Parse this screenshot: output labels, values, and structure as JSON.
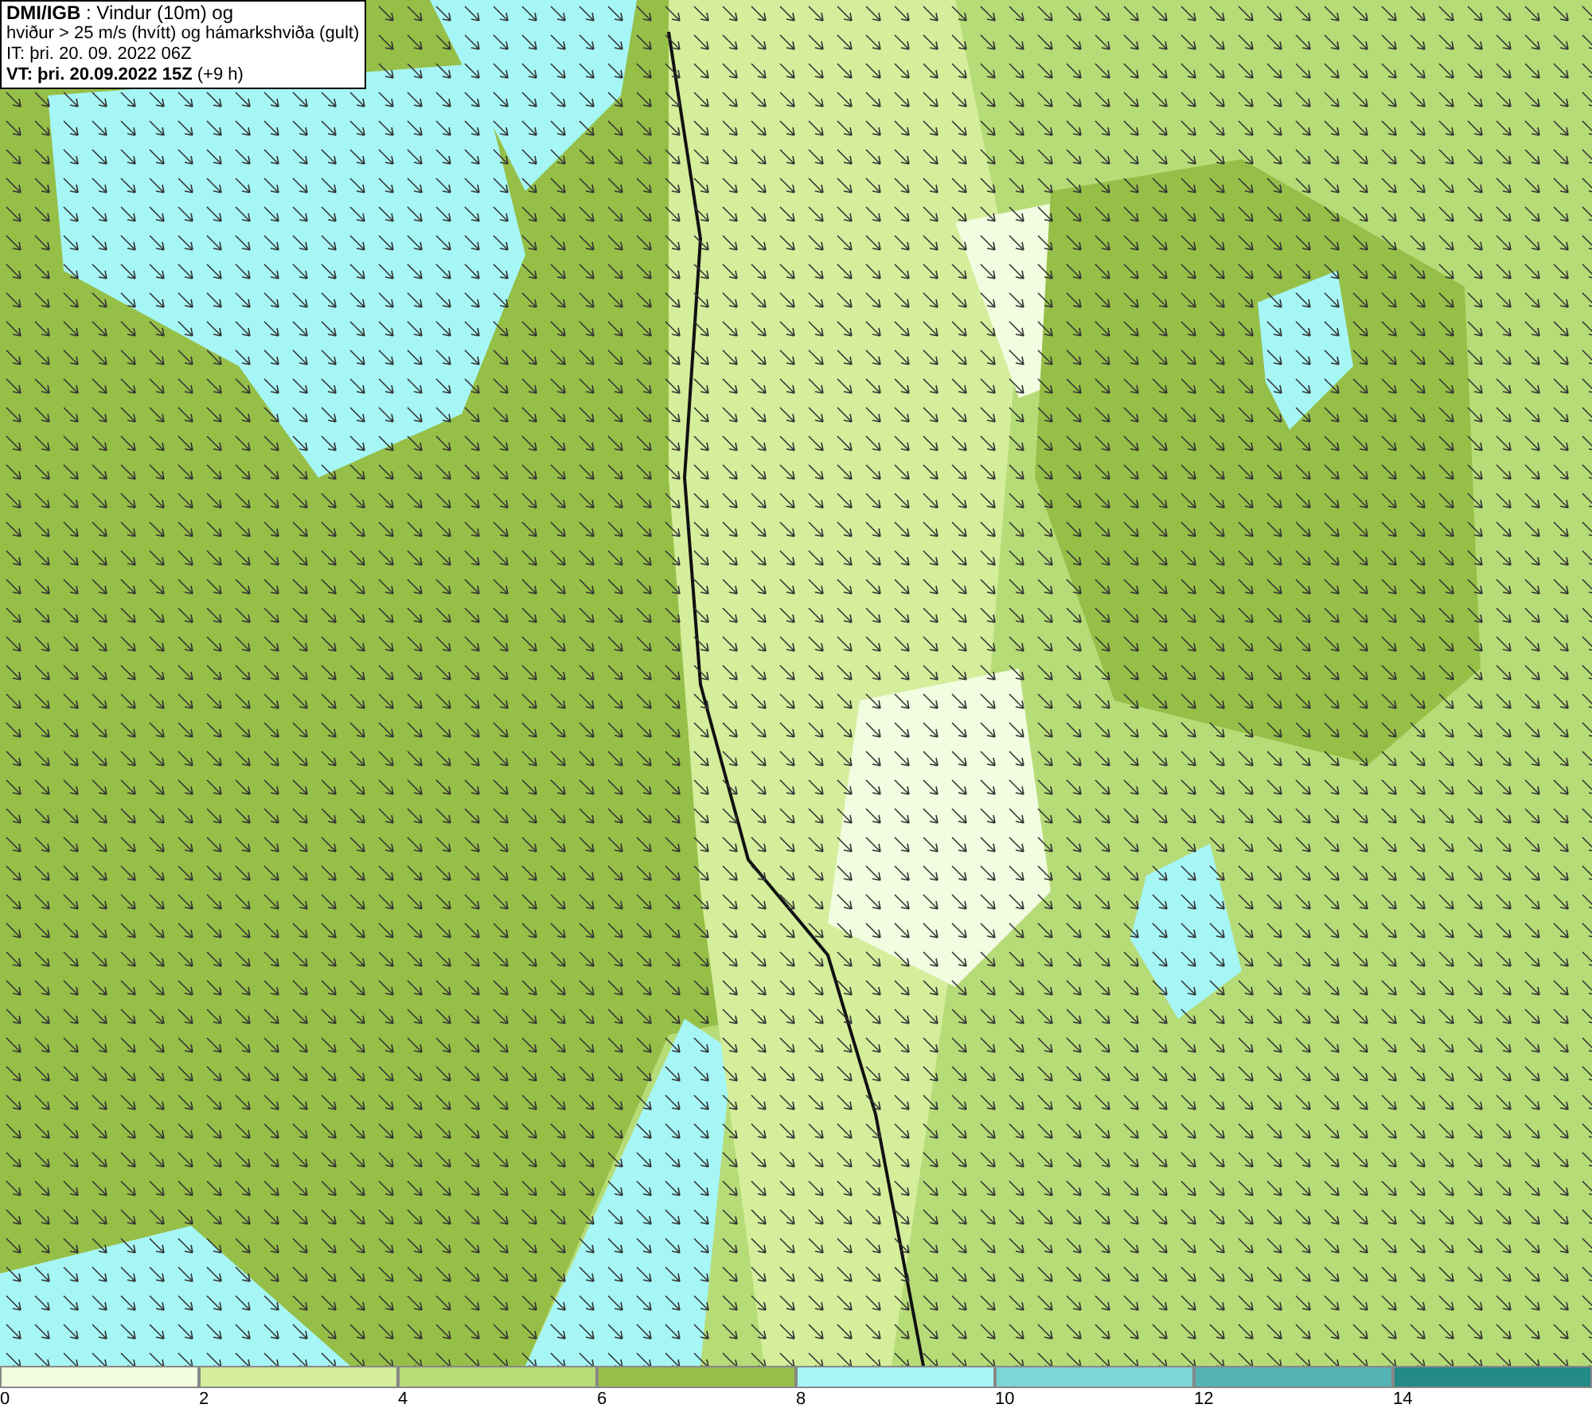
{
  "title_box": {
    "lines": [
      "**DMI/IGB** : Vindur (10m) og",
      "hviður > 25 m/s (hvítt) og hámarkshviða (gult)",
      "IT: þri. 20. 09. 2022 06Z",
      "**VT: þri. 20.09.2022 15Z** (+9 h)"
    ]
  },
  "legend": {
    "bins": [
      {
        "color": "#f2fce0"
      },
      {
        "color": "#d4ee9c"
      },
      {
        "color": "#b6dc78"
      },
      {
        "color": "#96bf48"
      },
      {
        "color": "#a6f6f6"
      },
      {
        "color": "#7dd6d6"
      },
      {
        "color": "#55b3b3"
      },
      {
        "color": "#238a85"
      }
    ],
    "ticks": [
      "0",
      "2",
      "4",
      "6",
      "8",
      "10",
      "12",
      "14"
    ]
  }
}
